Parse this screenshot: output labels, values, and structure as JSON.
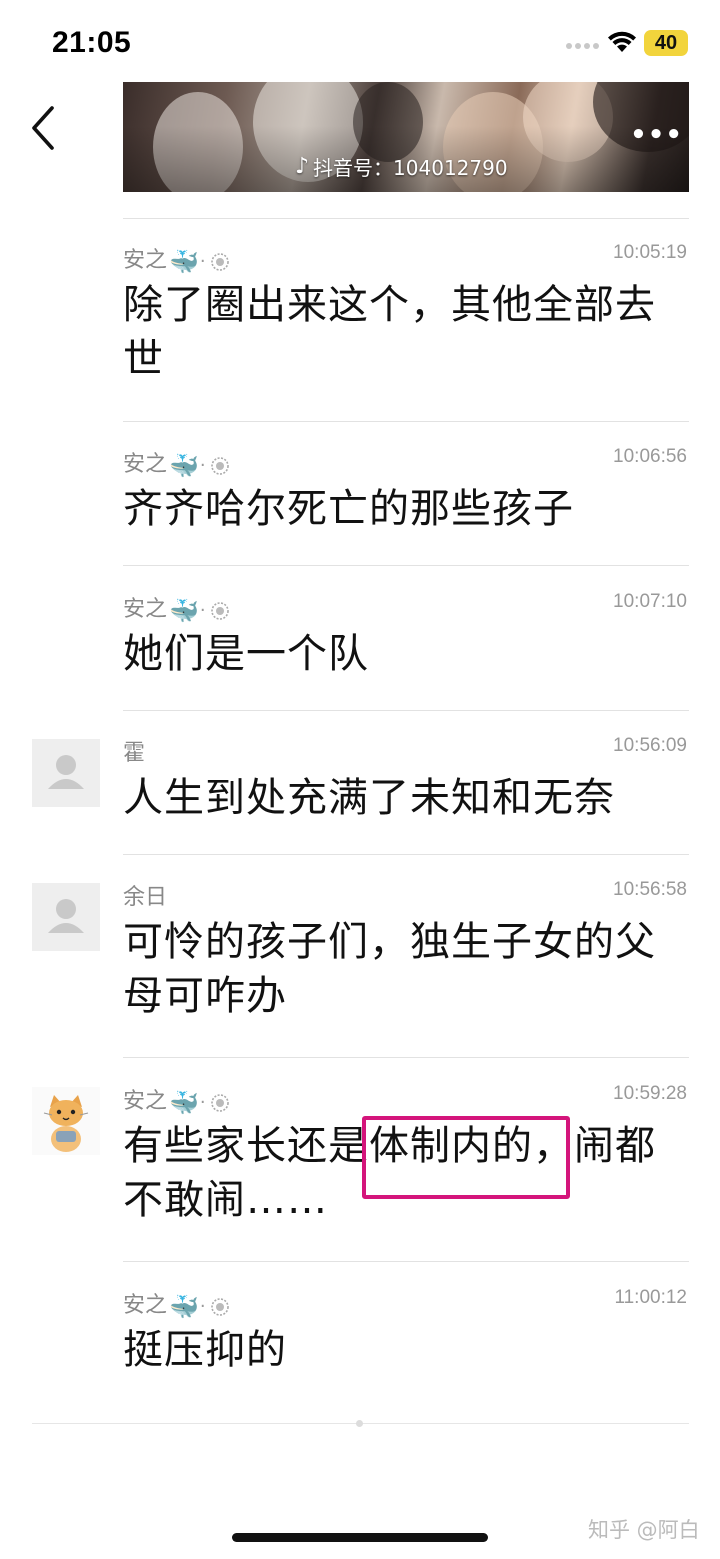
{
  "status_bar": {
    "time": "21:05",
    "battery": "40"
  },
  "video_card": {
    "douyin_label": "抖音号：104012790",
    "more": "•••"
  },
  "messages": [
    {
      "sender": "安之",
      "time": "10:05:19",
      "text": "除了圈出来这个，其他全部去世"
    },
    {
      "sender": "安之",
      "time": "10:06:56",
      "text": "齐齐哈尔死亡的那些孩子"
    },
    {
      "sender": "安之",
      "time": "10:07:10",
      "text": "她们是一个队"
    },
    {
      "sender": "霍",
      "time": "10:56:09",
      "text": "人生到处充满了未知和无奈"
    },
    {
      "sender": "余日",
      "time": "10:56:58",
      "text": "可怜的孩子们，独生子女的父母可咋办"
    },
    {
      "sender": "安之",
      "time": "10:59:28",
      "text": "有些家长还是体制内的，闹都不敢闹……"
    },
    {
      "sender": "安之",
      "time": "11:00:12",
      "text": "挺压抑的"
    }
  ],
  "badges": {
    "whale": "🐳",
    "dot": "·"
  },
  "highlight_color": "#d4157b",
  "watermark": "知乎 @阿白"
}
